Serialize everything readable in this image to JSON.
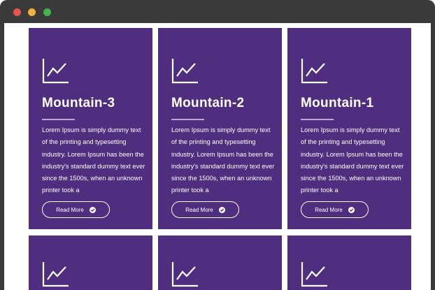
{
  "window": {
    "controls": [
      "close",
      "minimize",
      "maximize"
    ]
  },
  "cards": [
    {
      "icon": "line-chart-icon",
      "title": "Mountain-3",
      "description": "Lorem Ipsum is simply dummy text of the printing and typesetting industry. Lorem Ipsum has been the industry's standard dummy text ever since the 1500s, when an unknown printer took a",
      "button_label": "Read More"
    },
    {
      "icon": "line-chart-icon",
      "title": "Mountain-2",
      "description": "Lorem Ipsum is simply dummy text of the printing and typesetting industry. Lorem Ipsum has been the industry's standard dummy text ever since the 1500s, when an unknown printer took a",
      "button_label": "Read More"
    },
    {
      "icon": "line-chart-icon",
      "title": "Mountain-1",
      "description": "Lorem Ipsum is simply dummy text of the printing and typesetting industry. Lorem Ipsum has been the industry's standard dummy text ever since the 1500s, when an unknown printer took a",
      "button_label": "Read More"
    },
    {
      "icon": "line-chart-icon"
    },
    {
      "icon": "line-chart-icon"
    },
    {
      "icon": "line-chart-icon"
    }
  ],
  "colors": {
    "card_background": "#4f2d7f",
    "window_bar": "#3a3a3a",
    "close": "#e95352",
    "minimize": "#f2b33c",
    "maximize": "#46b44c"
  }
}
